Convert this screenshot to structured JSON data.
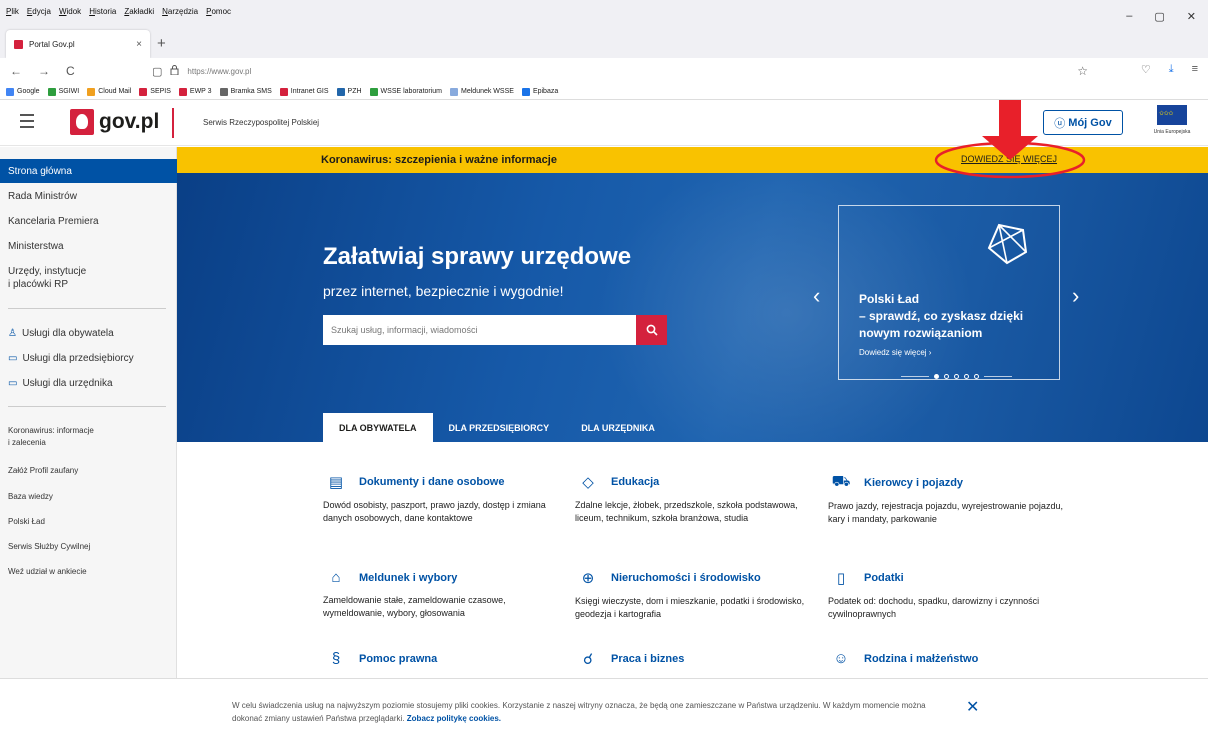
{
  "menubar": {
    "items": [
      "Plik",
      "Edycja",
      "Widok",
      "Historia",
      "Zakładki",
      "Narzędzia",
      "Pomoc"
    ]
  },
  "window": {
    "minimize": "–",
    "maximize": "▢",
    "close": "✕"
  },
  "tab": {
    "title": "Portal Gov.pl",
    "close": "×",
    "newtab": "+"
  },
  "nav": {
    "back": "←",
    "forward": "→",
    "reload": "C",
    "url": "https://www.gov.pl",
    "shield": "▢",
    "lock": "🔒︎",
    "star": "☆",
    "pocket": "♡",
    "download": "⤓",
    "menu": "≡"
  },
  "bookmarks": [
    {
      "label": "Google",
      "color": "#4285f4"
    },
    {
      "label": "SGIWI",
      "color": "#2e9e3e"
    },
    {
      "label": "Cloud Mail",
      "color": "#f0a020"
    },
    {
      "label": "SEPIS",
      "color": "#d4213d"
    },
    {
      "label": "EWP 3",
      "color": "#d4213d"
    },
    {
      "label": "Bramka SMS",
      "color": "#666666"
    },
    {
      "label": "Intranet GIS",
      "color": "#d4213d"
    },
    {
      "label": "PZH",
      "color": "#2266aa"
    },
    {
      "label": "WSSE laboratorium",
      "color": "#2e9e3e"
    },
    {
      "label": "Meldunek WSSE",
      "color": "#88aadd"
    },
    {
      "label": "Epibaza",
      "color": "#1a73e8"
    }
  ],
  "header": {
    "logo_text": "gov.pl",
    "serwis": "Serwis Rzeczypospolitej Polskiej",
    "moj_gov": "Mój Gov",
    "eu_label": "Unia Europejska"
  },
  "sidebar": {
    "active": "Strona główna",
    "main": [
      "Rada Ministrów",
      "Kancelaria Premiera",
      "Ministerstwa",
      "Urzędy, instytucje",
      "i placówki RP"
    ],
    "services": [
      {
        "label": "Usługi dla obywatela",
        "icon": "person-icon"
      },
      {
        "label": "Usługi dla przedsiębiorcy",
        "icon": "briefcase-icon"
      },
      {
        "label": "Usługi dla urzędnika",
        "icon": "monitor-icon"
      }
    ],
    "links": [
      "Koronawirus: informacje",
      "i zalecenia",
      "Załóż Profil zaufany",
      "Baza wiedzy",
      "Polski Ład",
      "Serwis Służby Cywilnej",
      "Weź udział w ankiecie"
    ]
  },
  "banner": {
    "text": "Koronawirus: szczepienia i ważne informacje",
    "link": "DOWIEDZ SIĘ WIĘCEJ"
  },
  "hero": {
    "title": "Załatwiaj sprawy urzędowe",
    "subtitle": "przez internet, bezpiecznie i wygodnie!",
    "search_placeholder": "Szukaj usług, informacji, wiadomości",
    "tabs": [
      "DLA OBYWATELA",
      "DLA PRZEDSIĘBIORCY",
      "DLA URZĘDNIKA"
    ],
    "promo_title_1": "Polski Ład",
    "promo_title_2": "– sprawdź, co zyskasz dzięki",
    "promo_title_3": "nowym rozwiązaniom",
    "promo_link": "Dowiedz się więcej ›",
    "prev": "‹",
    "next": "›"
  },
  "categories": [
    {
      "title": "Dokumenty i dane osobowe",
      "icon": "id-card-icon",
      "glyph": "▤",
      "desc": "Dowód osobisty, paszport, prawo jazdy, dostęp i zmiana danych osobowych, dane kontaktowe"
    },
    {
      "title": "Edukacja",
      "icon": "graduation-cap-icon",
      "glyph": "◇",
      "desc": "Zdalne lekcje, żłobek, przedszkole, szkoła podstawowa, liceum, technikum, szkoła branżowa, studia"
    },
    {
      "title": "Kierowcy i pojazdy",
      "icon": "car-icon",
      "glyph": "⛟",
      "desc": "Prawo jazdy, rejestracja pojazdu, wyrejestrowanie pojazdu, kary i mandaty, parkowanie"
    },
    {
      "title": "Meldunek i wybory",
      "icon": "house-icon",
      "glyph": "⌂",
      "desc": "Zameldowanie stałe, zameldowanie czasowe, wymeldowanie, wybory, głosowania"
    },
    {
      "title": "Nieruchomości i środowisko",
      "icon": "building-globe-icon",
      "glyph": "⊕",
      "desc": "Księgi wieczyste, dom i mieszkanie, podatki i środowisko, geodezja i kartografia"
    },
    {
      "title": "Podatki",
      "icon": "pit-document-icon",
      "glyph": "▯",
      "desc": "Podatek od: dochodu, spadku, darowizny i czynności cywilnoprawnych"
    },
    {
      "title": "Pomoc prawna",
      "icon": "paragraph-icon",
      "glyph": "§",
      "desc": ""
    },
    {
      "title": "Praca i biznes",
      "icon": "handshake-icon",
      "glyph": "☌",
      "desc": ""
    },
    {
      "title": "Rodzina i małżeństwo",
      "icon": "family-icon",
      "glyph": "☺",
      "desc": ""
    }
  ],
  "cookie": {
    "text": "W celu świadczenia usług na najwyższym poziomie stosujemy pliki cookies. Korzystanie z naszej witryny oznacza, że będą one zamieszczane w Państwa urządzeniu. W każdym momencie można dokonać zmiany ustawień Państwa przeglądarki.",
    "link": "Zobacz politykę cookies.",
    "close": "✕"
  },
  "annotation_color": "#e8202a"
}
